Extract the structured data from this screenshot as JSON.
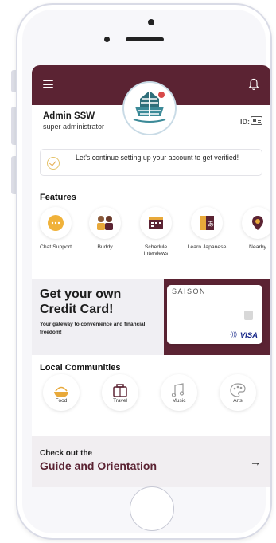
{
  "profile": {
    "name": "Admin SSW",
    "role": "super administrator",
    "id_label": "ID:"
  },
  "verify": {
    "message": "Let's continue setting up your account to get verified!"
  },
  "features": {
    "title": "Features",
    "items": [
      {
        "label": "Chat Support",
        "icon": "chat-bubble-icon"
      },
      {
        "label": "Buddy",
        "icon": "buddy-people-icon"
      },
      {
        "label": "Schedule Interviews",
        "icon": "calendar-icon"
      },
      {
        "label": "Learn Japanese",
        "icon": "book-icon"
      },
      {
        "label": "Nearby",
        "icon": "map-pin-icon"
      }
    ]
  },
  "credit": {
    "title_line1": "Get your own",
    "title_line2": "Credit Card!",
    "subtitle": "Your gateway to convenience and financial freedom!",
    "card_brand": "SAISON",
    "card_network": "VISA",
    "contactless": "·)))"
  },
  "communities": {
    "title": "Local Communities",
    "items": [
      {
        "label": "Food",
        "icon": "food-bowl-icon"
      },
      {
        "label": "Travel",
        "icon": "suitcase-icon"
      },
      {
        "label": "Music",
        "icon": "music-note-icon"
      },
      {
        "label": "Arts",
        "icon": "palette-icon"
      }
    ]
  },
  "guide": {
    "small": "Check out the",
    "big": "Guide and Orientation",
    "arrow": "→"
  },
  "colors": {
    "brand": "#5b2333",
    "accent": "#e8a93a"
  }
}
